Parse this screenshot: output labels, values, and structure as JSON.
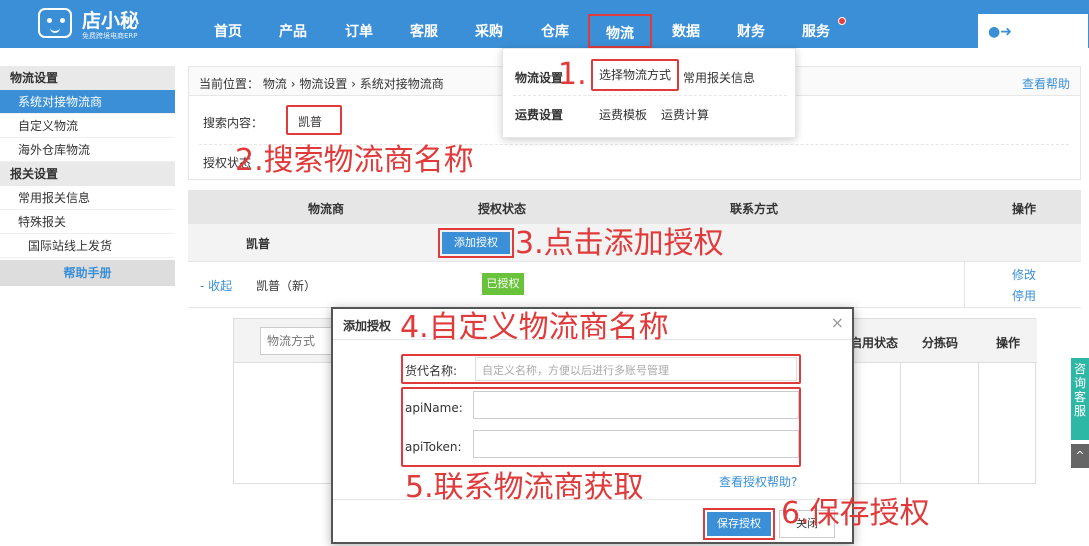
{
  "app": {
    "logo_text": "店小秘",
    "logo_sub": "免费跨境电商ERP"
  },
  "nav": {
    "items": [
      "首页",
      "产品",
      "订单",
      "客服",
      "采购",
      "仓库",
      "物流",
      "数据",
      "财务",
      "服务"
    ],
    "active": "物流"
  },
  "sidebar": {
    "group1_title": "物流设置",
    "group1_items": [
      "系统对接物流商",
      "自定义物流",
      "海外仓库物流"
    ],
    "group2_title": "报关设置",
    "group2_items": [
      "常用报关信息",
      "特殊报关"
    ],
    "sub_item": "国际站线上发货",
    "help": "帮助手册"
  },
  "breadcrumb": {
    "prefix": "当前位置：",
    "parts": [
      "物流",
      "物流设置",
      "系统对接物流商"
    ],
    "help_link": "查看帮助"
  },
  "filter": {
    "search_label": "搜索内容：",
    "search_value": "凯普",
    "auth_label": "授权状态"
  },
  "table": {
    "headers": [
      "物流商",
      "授权状态",
      "联系方式",
      "操作"
    ],
    "group_name": "凯普",
    "add_auth_button": "添加授权",
    "row": {
      "fold": "- 收起",
      "name": "凯普（新）",
      "status": "已授权",
      "op_edit": "修改",
      "op_disable": "停用"
    }
  },
  "subtable": {
    "placeholder": "物流方式",
    "headers": [
      "启用状态",
      "分拣码",
      "操作"
    ]
  },
  "dropdown": {
    "label1": "物流设置",
    "item_selected": "选择物流方式",
    "item2": "常用报关信息",
    "label2": "运费设置",
    "item3": "运费模板",
    "item4": "运费计算"
  },
  "modal": {
    "title": "添加授权",
    "close": "×",
    "forwarder_label": "货代名称:",
    "forwarder_placeholder": "自定义名称，方便以后进行多账号管理",
    "api_name_label": "apiName:",
    "api_token_label": "apiToken:",
    "help_link": "查看授权帮助?",
    "save_button": "保存授权",
    "cancel_button": "关闭"
  },
  "annotations": {
    "step1": "1.",
    "step2": "2.搜索物流商名称",
    "step3": "3.点击添加授权",
    "step4": "4.自定义物流商名称",
    "step5": "5.联系物流商获取",
    "step6": "6.保存授权"
  },
  "side_widget": {
    "consult": "咨询客服",
    "up": "^"
  },
  "colors": {
    "primary": "#3a8fd6",
    "highlight": "#e03a3a",
    "success": "#68c23a"
  }
}
